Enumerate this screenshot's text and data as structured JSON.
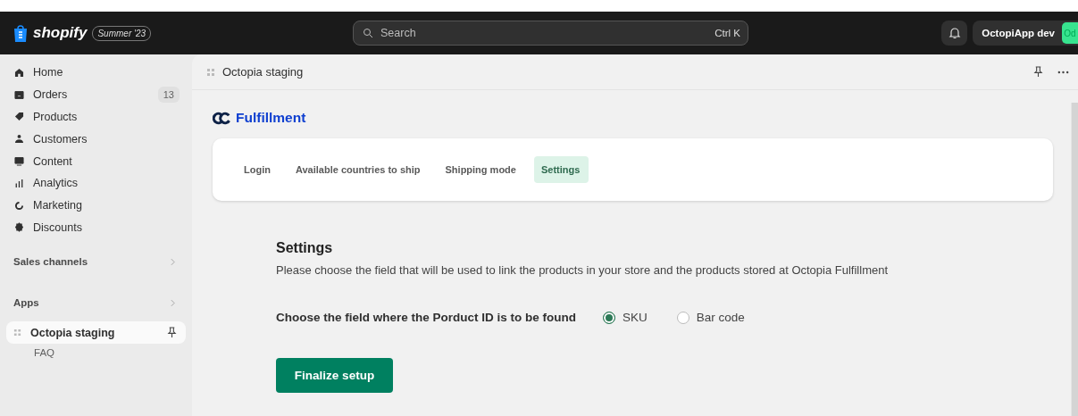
{
  "topbar": {
    "brand": "shopify",
    "edition": "Summer '23",
    "search": {
      "placeholder": "Search",
      "shortcut": "Ctrl K"
    },
    "account": {
      "name": "OctopiApp dev",
      "initials": "Od"
    }
  },
  "sidebar": {
    "items": [
      {
        "label": "Home",
        "selected": false
      },
      {
        "label": "Orders",
        "badge": "13",
        "selected": false
      },
      {
        "label": "Products",
        "selected": false
      },
      {
        "label": "Customers",
        "selected": false
      },
      {
        "label": "Content",
        "selected": false
      },
      {
        "label": "Analytics",
        "selected": false
      },
      {
        "label": "Marketing",
        "selected": false
      },
      {
        "label": "Discounts",
        "selected": false
      }
    ],
    "sections": [
      {
        "label": "Sales channels"
      },
      {
        "label": "Apps"
      }
    ],
    "apps": [
      {
        "label": "Octopia staging",
        "selected": true,
        "children": [
          {
            "label": "FAQ"
          }
        ]
      }
    ]
  },
  "page": {
    "title": "Octopia staging",
    "app_name": "Fulfillment",
    "tabs": [
      {
        "label": "Login",
        "selected": false
      },
      {
        "label": "Available countries to ship",
        "selected": false
      },
      {
        "label": "Shipping mode",
        "selected": false
      },
      {
        "label": "Settings",
        "selected": true
      }
    ],
    "heading": "Settings",
    "description": "Please choose the field that will be used to link the products in your store and the products stored at Octopia Fulfillment",
    "field_label": "Choose the field where the Porduct ID is to be found",
    "options": [
      {
        "label": "SKU",
        "selected": true
      },
      {
        "label": "Bar code",
        "selected": false
      }
    ],
    "button": "Finalize setup"
  }
}
